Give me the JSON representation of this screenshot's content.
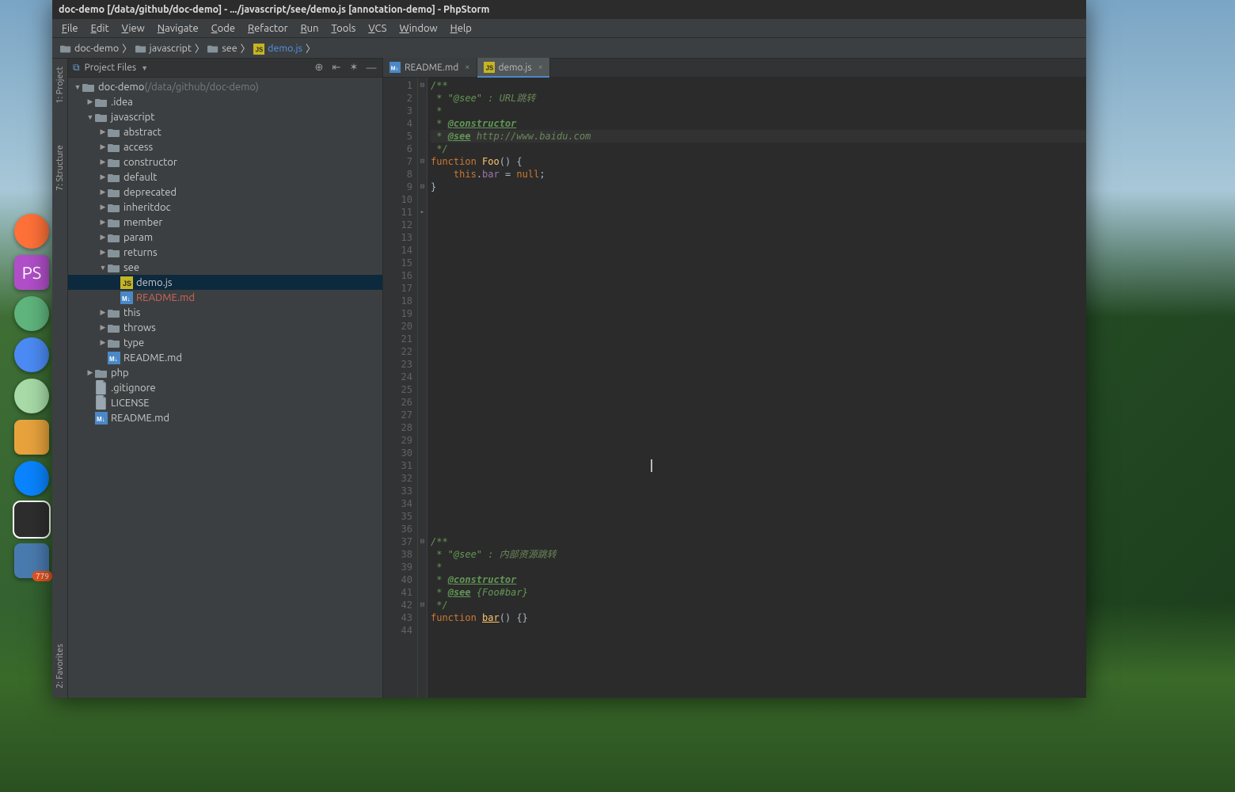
{
  "title": "doc-demo [/data/github/doc-demo] - .../javascript/see/demo.js [annotation-demo] - PhpStorm",
  "menu": [
    "File",
    "Edit",
    "View",
    "Navigate",
    "Code",
    "Refactor",
    "Run",
    "Tools",
    "VCS",
    "Window",
    "Help"
  ],
  "breadcrumbs": [
    {
      "label": "doc-demo",
      "icon": "folder"
    },
    {
      "label": "javascript",
      "icon": "folder"
    },
    {
      "label": "see",
      "icon": "folder"
    },
    {
      "label": "demo.js",
      "icon": "js",
      "link": true
    }
  ],
  "project_panel": {
    "title": "Project Files",
    "toolbar_icons": [
      "target",
      "collapse",
      "settings",
      "hide"
    ]
  },
  "tree": [
    {
      "d": 0,
      "a": "open",
      "i": "folder-root",
      "t": "doc-demo",
      "suffix": " (/data/github/doc-demo)"
    },
    {
      "d": 1,
      "a": "closed",
      "i": "folder",
      "t": ".idea"
    },
    {
      "d": 1,
      "a": "open",
      "i": "folder",
      "t": "javascript"
    },
    {
      "d": 2,
      "a": "closed",
      "i": "folder",
      "t": "abstract"
    },
    {
      "d": 2,
      "a": "closed",
      "i": "folder",
      "t": "access"
    },
    {
      "d": 2,
      "a": "closed",
      "i": "folder",
      "t": "constructor"
    },
    {
      "d": 2,
      "a": "closed",
      "i": "folder",
      "t": "default"
    },
    {
      "d": 2,
      "a": "closed",
      "i": "folder",
      "t": "deprecated"
    },
    {
      "d": 2,
      "a": "closed",
      "i": "folder",
      "t": "inheritdoc"
    },
    {
      "d": 2,
      "a": "closed",
      "i": "folder",
      "t": "member"
    },
    {
      "d": 2,
      "a": "closed",
      "i": "folder",
      "t": "param"
    },
    {
      "d": 2,
      "a": "closed",
      "i": "folder",
      "t": "returns"
    },
    {
      "d": 2,
      "a": "open",
      "i": "folder",
      "t": "see"
    },
    {
      "d": 3,
      "a": "none",
      "i": "js",
      "t": "demo.js",
      "sel": true
    },
    {
      "d": 3,
      "a": "none",
      "i": "md",
      "t": "README.md",
      "cls": "orange"
    },
    {
      "d": 2,
      "a": "closed",
      "i": "folder",
      "t": "this"
    },
    {
      "d": 2,
      "a": "closed",
      "i": "folder",
      "t": "throws"
    },
    {
      "d": 2,
      "a": "closed",
      "i": "folder",
      "t": "type"
    },
    {
      "d": 2,
      "a": "none",
      "i": "md",
      "t": "README.md"
    },
    {
      "d": 1,
      "a": "closed",
      "i": "folder",
      "t": "php"
    },
    {
      "d": 1,
      "a": "none",
      "i": "txt",
      "t": ".gitignore"
    },
    {
      "d": 1,
      "a": "none",
      "i": "txt",
      "t": "LICENSE"
    },
    {
      "d": 1,
      "a": "none",
      "i": "md",
      "t": "README.md"
    }
  ],
  "tabs": [
    {
      "label": "README.md",
      "icon": "md",
      "active": false
    },
    {
      "label": "demo.js",
      "icon": "js",
      "active": true
    }
  ],
  "tool_windows": {
    "left": [
      {
        "label": "1: Project"
      },
      {
        "label": "7: Structure"
      }
    ],
    "left_bottom": [
      {
        "label": "2: Favorites"
      }
    ]
  },
  "code": {
    "lines": [
      {
        "n": 1,
        "fold": "⊟",
        "html": "<span class='d'>/**</span>"
      },
      {
        "n": 2,
        "html": "<span class='d'> * \"@see\" : </span><span class='dl'>URL跳转</span>"
      },
      {
        "n": 3,
        "html": "<span class='d'> *</span>"
      },
      {
        "n": 4,
        "html": "<span class='d'> * </span><span class='dt'>@constructor</span>"
      },
      {
        "n": 5,
        "hl": true,
        "html": "<span class='d'> * </span><span class='dt'>@see</span><span class='d'> </span><span class='dl'>http://www.</span><span class='dl'>baidu.com</span>"
      },
      {
        "n": 6,
        "html": "<span class='d'> */</span>"
      },
      {
        "n": 7,
        "fold": "⊟",
        "html": "<span class='k'>function </span><span class='fn'>Foo</span><span class='n'>() {</span>"
      },
      {
        "n": 8,
        "html": "<span class='n'>    </span><span class='k'>this</span><span class='n'>.</span><span class='p'>bar</span><span class='n'> = </span><span class='k'>null</span><span class='n'>;</span>"
      },
      {
        "n": 9,
        "fold": "⊟",
        "html": "<span class='n'>}</span>"
      },
      {
        "n": 10,
        "html": ""
      },
      {
        "n": 11,
        "fold": "▸",
        "html": ""
      },
      {
        "n": 12,
        "html": ""
      },
      {
        "n": 13,
        "html": ""
      },
      {
        "n": 14,
        "html": ""
      },
      {
        "n": 15,
        "html": ""
      },
      {
        "n": 16,
        "html": ""
      },
      {
        "n": 17,
        "html": ""
      },
      {
        "n": 18,
        "html": ""
      },
      {
        "n": 19,
        "html": ""
      },
      {
        "n": 20,
        "html": ""
      },
      {
        "n": 21,
        "html": ""
      },
      {
        "n": 22,
        "html": ""
      },
      {
        "n": 23,
        "html": ""
      },
      {
        "n": 24,
        "html": ""
      },
      {
        "n": 25,
        "html": ""
      },
      {
        "n": 26,
        "html": ""
      },
      {
        "n": 27,
        "html": ""
      },
      {
        "n": 28,
        "html": ""
      },
      {
        "n": 29,
        "html": ""
      },
      {
        "n": 30,
        "html": ""
      },
      {
        "n": 31,
        "html": ""
      },
      {
        "n": 32,
        "html": ""
      },
      {
        "n": 33,
        "html": ""
      },
      {
        "n": 34,
        "html": ""
      },
      {
        "n": 35,
        "html": ""
      },
      {
        "n": 36,
        "html": ""
      },
      {
        "n": 37,
        "fold": "⊟",
        "html": "<span class='d'>/**</span>"
      },
      {
        "n": 38,
        "html": "<span class='d'> * \"@see\" : </span><span class='dl'>内部资源跳转</span>"
      },
      {
        "n": 39,
        "html": "<span class='d'> *</span>"
      },
      {
        "n": 40,
        "html": "<span class='d'> * </span><span class='dt'>@constructor</span>"
      },
      {
        "n": 41,
        "html": "<span class='d'> * </span><span class='dt'>@see</span><span class='d'> {Foo#bar}</span>"
      },
      {
        "n": 42,
        "fold": "⊟",
        "html": "<span class='d'> */</span>"
      },
      {
        "n": 43,
        "html": "<span class='k'>function </span><span class='fn' style='text-decoration:underline'>bar</span><span class='n'>() {}</span>"
      },
      {
        "n": 44,
        "html": ""
      }
    ]
  },
  "dock": [
    {
      "name": "firefox",
      "color": "#ff7139"
    },
    {
      "name": "phpstorm",
      "color": "#b14fc9",
      "sq": true,
      "label": "PS"
    },
    {
      "name": "atom",
      "color": "#5fb57d"
    },
    {
      "name": "chrome",
      "color": "#4c8bf5"
    },
    {
      "name": "wechat",
      "color": "#a8dba8"
    },
    {
      "name": "files",
      "color": "#e8a33d",
      "sq": true
    },
    {
      "name": "firefox-dev",
      "color": "#0a84ff"
    },
    {
      "name": "terminal",
      "color": "#2e2e2e",
      "sq": true,
      "active": true
    },
    {
      "name": "unknown",
      "color": "#4a7bb0",
      "sq": true,
      "badge": "779"
    }
  ]
}
